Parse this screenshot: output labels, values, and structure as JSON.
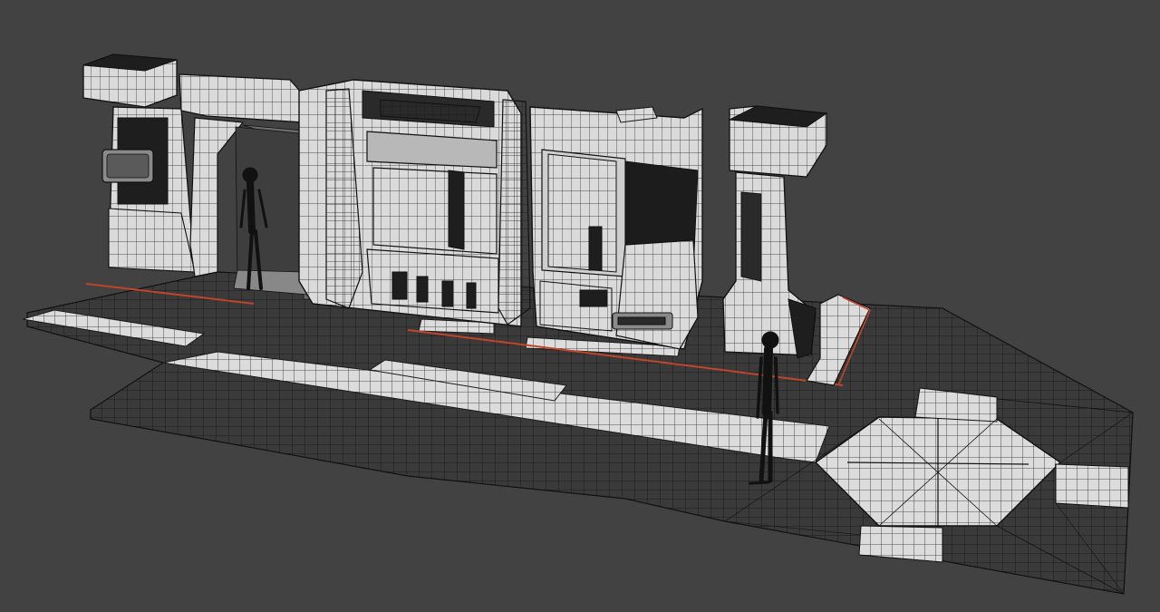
{
  "viewport": {
    "background": "#424242",
    "mesh_fill": "#d9d9d9",
    "mesh_shade": "#a8a8a8",
    "wire_color": "#1a1a1a",
    "panel_dark": "#1e1e1e",
    "accent_line": "#c0452a",
    "figure_color": "#111111"
  },
  "scene": {
    "subject": "wireframe-3d-scifi-corridor",
    "figures": 2
  }
}
